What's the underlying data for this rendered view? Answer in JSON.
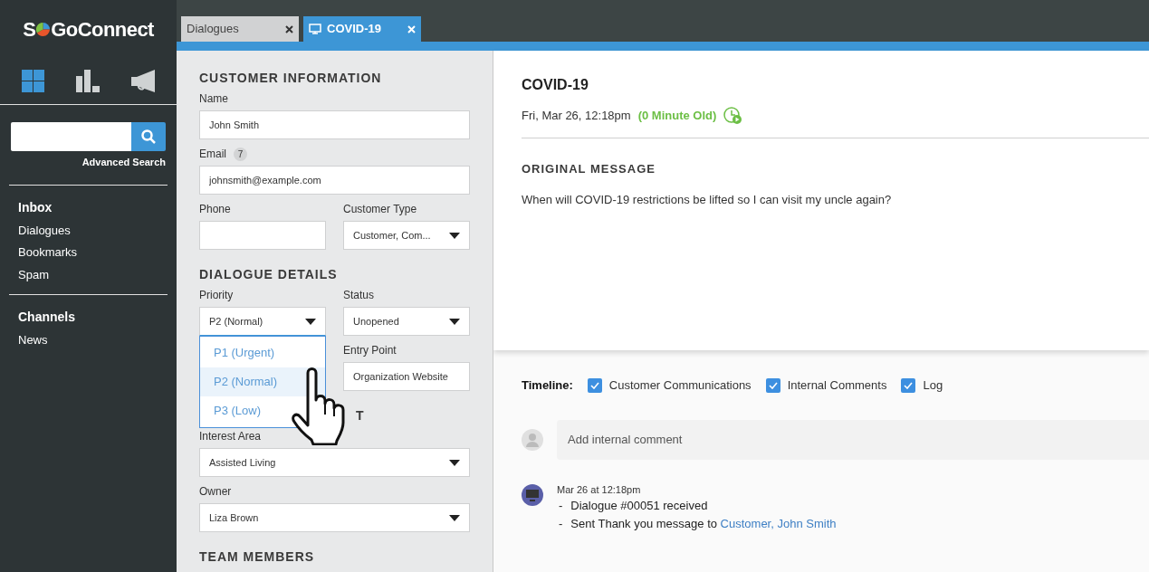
{
  "sidebar": {
    "logo": {
      "start": "S",
      "end": "GoConnect"
    },
    "nav_icons": [
      {
        "kind": "dashboard",
        "selected": true
      },
      {
        "kind": "reports",
        "selected": false
      },
      {
        "kind": "campaigns",
        "selected": false
      }
    ],
    "search": {
      "link": "Advanced Search"
    },
    "groups": [
      {
        "title": "Inbox",
        "items": [
          "Dialogues",
          "Bookmarks",
          "Spam"
        ]
      },
      {
        "title": "Channels",
        "items": [
          "News"
        ]
      }
    ]
  },
  "tabs": [
    {
      "label": "Dialogues",
      "selected": false,
      "icon": false
    },
    {
      "label": "COVID-19",
      "selected": true,
      "icon": true
    }
  ],
  "form": {
    "sections": [
      {
        "title": "CUSTOMER INFORMATION",
        "rows": [
          [
            {
              "kind": "input",
              "label": "Name",
              "value": "John Smith"
            }
          ],
          [
            {
              "kind": "input",
              "label": "Email",
              "badge": "7",
              "value": "johnsmith@example.com"
            }
          ],
          [
            {
              "kind": "input",
              "label": "Phone"
            },
            {
              "kind": "select",
              "label": "Customer Type",
              "value": "Customer, Com..."
            }
          ]
        ]
      },
      {
        "title": "DIALOGUE DETAILS",
        "rows": [
          [
            {
              "kind": "select",
              "label": "Priority",
              "value": "P2 (Normal)",
              "open": true,
              "options": [
                {
                  "label": "P1 (Urgent)",
                  "selected": false
                },
                {
                  "label": "P2 (Normal)",
                  "selected": true
                },
                {
                  "label": "P3 (Low)",
                  "selected": false
                }
              ]
            },
            {
              "kind": "select",
              "label": "Status",
              "value": "Unopened"
            }
          ],
          [
            {
              "kind": "spacer"
            },
            {
              "kind": "input",
              "label": "Entry Point",
              "value": "Organization Website"
            }
          ]
        ]
      },
      {
        "title": "T",
        "covered": true,
        "rows": [
          [
            {
              "kind": "select",
              "label": "Interest Area",
              "value": "Assisted Living"
            }
          ],
          [
            {
              "kind": "select",
              "label": "Owner",
              "value": "Liza Brown"
            }
          ]
        ]
      },
      {
        "title": "TEAM MEMBERS"
      }
    ]
  },
  "dialogue": {
    "title": "COVID-19",
    "date": "Fri, Mar 26, 12:18pm",
    "age": "(0 Minute Old)",
    "message_heading": "ORIGINAL MESSAGE",
    "message": "When will COVID-19 restrictions be lifted so I can visit my uncle again?"
  },
  "timeline": {
    "label": "Timeline:",
    "filters": [
      {
        "label": "Customer Communications",
        "checked": true
      },
      {
        "label": "Internal Comments",
        "checked": true
      },
      {
        "label": "Log",
        "checked": true
      }
    ],
    "comment_placeholder": "Add internal comment",
    "entries": [
      {
        "time": "Mar 26 at 12:18pm",
        "lines": [
          {
            "dash": "-",
            "text": "Dialogue #00051 received"
          },
          {
            "dash": "-",
            "text": "Sent Thank you message to ",
            "link": "Customer, John Smith"
          }
        ]
      }
    ]
  }
}
